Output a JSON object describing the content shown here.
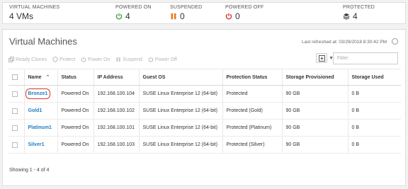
{
  "summary": {
    "virtual_machines": {
      "label": "Virtual Machines",
      "value": "4 VMs"
    },
    "powered_on": {
      "label": "Powered On",
      "value": "4",
      "color": "#3aa53a",
      "icon": "power-icon"
    },
    "suspended": {
      "label": "Suspended",
      "value": "0",
      "color": "#e8781e",
      "icon": "pause-icon"
    },
    "powered_off": {
      "label": "Powered Off",
      "value": "0",
      "color": "#d9342b",
      "icon": "power-icon"
    },
    "protected": {
      "label": "Protected",
      "value": "4",
      "icon": "stack-icon"
    }
  },
  "panel": {
    "title": "Virtual Machines",
    "last_refreshed": "Last refreshed at: 03/29/2018 8:30:42 PM"
  },
  "toolbar": {
    "ready_clones": "Ready Clones",
    "protect": "Protect",
    "power_on": "Power On",
    "suspend": "Suspend",
    "power_off": "Power Off"
  },
  "filter": {
    "placeholder": "Filter",
    "value": ""
  },
  "table": {
    "headers": {
      "name": "Name",
      "status": "Status",
      "ip": "IP Address",
      "os": "Guest OS",
      "protection": "Protection Status",
      "storage_provisioned": "Storage Provisioned",
      "storage_used": "Storage Used"
    },
    "rows": [
      {
        "name": "Bronze1",
        "status": "Powered On",
        "ip": "192.168.100.104",
        "os": "SUSE Linux Enterprise 12 (64-bit)",
        "protection": "Protected",
        "storage_provisioned": "90 GB",
        "storage_used": "0 B"
      },
      {
        "name": "Gold1",
        "status": "Powered On",
        "ip": "192.168.100.102",
        "os": "SUSE Linux Enterprise 12 (64-bit)",
        "protection": "Protected (Gold)",
        "storage_provisioned": "90 GB",
        "storage_used": "0 B"
      },
      {
        "name": "Platinum1",
        "status": "Powered On",
        "ip": "192.168.100.101",
        "os": "SUSE Linux Enterprise 12 (64-bit)",
        "protection": "Protected (Platinum)",
        "storage_provisioned": "90 GB",
        "storage_used": "0 B"
      },
      {
        "name": "Silver1",
        "status": "Powered On",
        "ip": "192.168.100.103",
        "os": "SUSE Linux Enterprise 12 (64-bit)",
        "protection": "Protected (Silver)",
        "storage_provisioned": "90 GB",
        "storage_used": "0 B"
      }
    ]
  },
  "footer": {
    "showing": "Showing 1 - 4 of 4"
  }
}
